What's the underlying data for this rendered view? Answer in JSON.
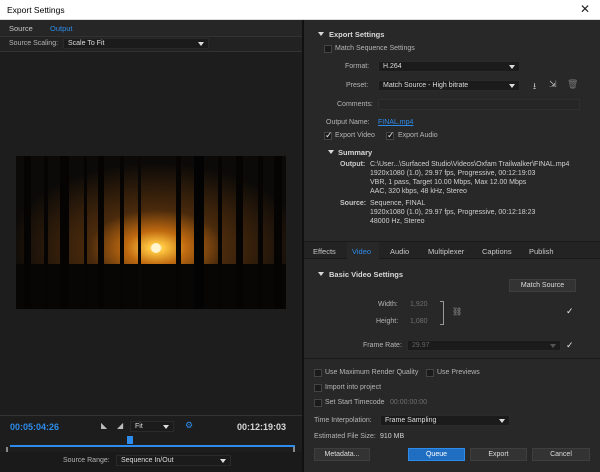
{
  "window": {
    "title": "Export Settings",
    "close_glyph": "✕"
  },
  "source_tabs": [
    "Source",
    "Output"
  ],
  "source_scaling": {
    "label": "Source Scaling:",
    "value": "Scale To Fit"
  },
  "timeline": {
    "start_time": "00:05:04:26",
    "fit_label": "Fit",
    "end_time": "00:12:19:03",
    "playhead_fraction": 0.42
  },
  "source_range": {
    "label": "Source Range:",
    "value": "Sequence In/Out"
  },
  "export_settings": {
    "header": "Export Settings",
    "match_sequence": "Match Sequence Settings",
    "format_label": "Format:",
    "format_value": "H.264",
    "preset_label": "Preset:",
    "preset_value": "Match Source - High bitrate",
    "comments_label": "Comments:",
    "output_name_label": "Output Name:",
    "output_name_value": "FINAL.mp4",
    "export_video": "Export Video",
    "export_audio": "Export Audio"
  },
  "summary": {
    "header": "Summary",
    "output_label": "Output:",
    "output_lines": [
      "C:\\User...\\Surfaced Studio\\Videos\\Oxfam Trailwalker\\FINAL.mp4",
      "1920x1080 (1.0), 29.97 fps, Progressive, 00:12:19:03",
      "VBR, 1 pass, Target 10.00 Mbps, Max 12.00 Mbps",
      "AAC, 320 kbps, 48 kHz, Stereo"
    ],
    "source_label": "Source:",
    "source_lines": [
      "Sequence, FINAL",
      "1920x1080 (1.0), 29.97 fps, Progressive, 00:12:18:23",
      "48000 Hz, Stereo"
    ]
  },
  "settings_tabs": [
    "Effects",
    "Video",
    "Audio",
    "Multiplexer",
    "Captions",
    "Publish"
  ],
  "video": {
    "header": "Basic Video Settings",
    "match_source": "Match Source",
    "width_label": "Width:",
    "width_value": "1,920",
    "height_label": "Height:",
    "height_value": "1,080",
    "frame_rate_label": "Frame Rate:",
    "frame_rate_value": "29.97"
  },
  "options": {
    "max_render": "Use Maximum Render Quality",
    "use_previews": "Use Previews",
    "import_project": "Import into project",
    "start_timecode": "Set Start Timecode",
    "start_timecode_value": "00:00:00:00",
    "time_interp_label": "Time Interpolation:",
    "time_interp_value": "Frame Sampling",
    "file_size_label": "Estimated File Size:",
    "file_size_value": "910 MB"
  },
  "buttons": {
    "metadata": "Metadata...",
    "queue": "Queue",
    "export": "Export",
    "cancel": "Cancel"
  },
  "colors": {
    "accent": "#2d8ceb",
    "panel": "#282828",
    "preview_sun": "#ffb020"
  }
}
